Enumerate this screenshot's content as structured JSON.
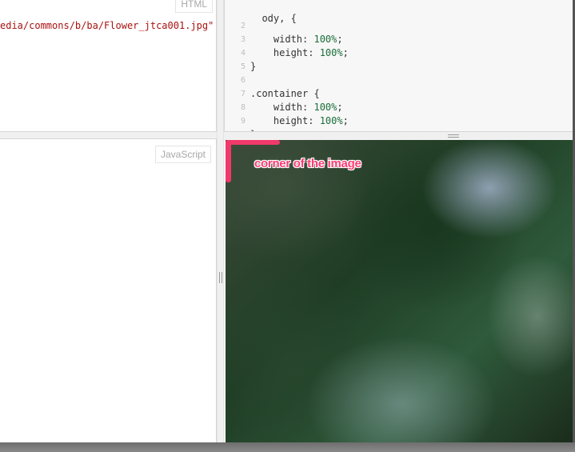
{
  "html_pane": {
    "label": "HTML",
    "code_line": "edia/commons/b/ba/Flower_jtca001.jpg\""
  },
  "css_pane": {
    "lines": [
      {
        "n": "",
        "text": "     width: ",
        "num": "100%",
        "tail": ";"
      },
      {
        "n": "2",
        "text": "    width: ",
        "num": "100%",
        "tail": ";"
      },
      {
        "n": "3",
        "text": "    height: ",
        "num": "100%",
        "tail": ";"
      },
      {
        "n": "4",
        "text": "}",
        "num": "",
        "tail": ""
      },
      {
        "n": "5",
        "text": "",
        "num": "",
        "tail": ""
      },
      {
        "n": "6",
        "text": ".container {",
        "num": "",
        "tail": ""
      },
      {
        "n": "7",
        "text": "    width: ",
        "num": "100%",
        "tail": ";"
      },
      {
        "n": "8",
        "text": "    height: ",
        "num": "100%",
        "tail": ";"
      },
      {
        "n": "9",
        "text": "}",
        "num": "",
        "tail": ""
      }
    ]
  },
  "js_pane": {
    "label": "JavaScript"
  },
  "result_pane": {
    "annotation": "corner of the image"
  },
  "colors": {
    "marker": "#f03a6a",
    "css_number": "#1b6e3a",
    "html_string": "#aa1111"
  }
}
